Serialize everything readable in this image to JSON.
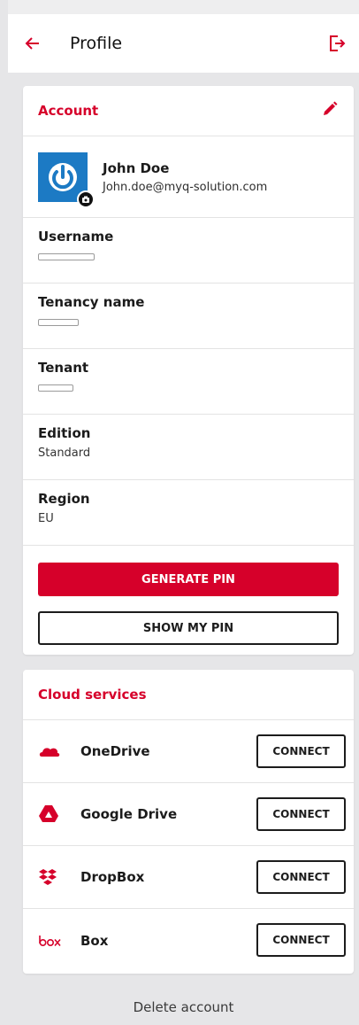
{
  "header": {
    "title": "Profile"
  },
  "account": {
    "section_title": "Account",
    "user": {
      "name": "John Doe",
      "email": "John.doe@myq-solution.com"
    },
    "fields": [
      {
        "label": "Username",
        "value": ""
      },
      {
        "label": "Tenancy name",
        "value": ""
      },
      {
        "label": "Tenant",
        "value": ""
      },
      {
        "label": "Edition",
        "value": "Standard"
      },
      {
        "label": "Region",
        "value": "EU"
      }
    ],
    "generate_pin_label": "GENERATE PIN",
    "show_pin_label": "SHOW MY PIN"
  },
  "cloud": {
    "section_title": "Cloud services",
    "services": [
      {
        "name": "OneDrive",
        "icon": "onedrive-icon",
        "action": "CONNECT"
      },
      {
        "name": "Google Drive",
        "icon": "google-drive-icon",
        "action": "CONNECT"
      },
      {
        "name": "DropBox",
        "icon": "dropbox-icon",
        "action": "CONNECT"
      },
      {
        "name": "Box",
        "icon": "box-icon",
        "action": "CONNECT"
      }
    ]
  },
  "footer": {
    "delete_label": "Delete account"
  },
  "colors": {
    "accent": "#d6002a",
    "avatar_bg": "#1c7ac4",
    "background": "#e6e6e8"
  }
}
